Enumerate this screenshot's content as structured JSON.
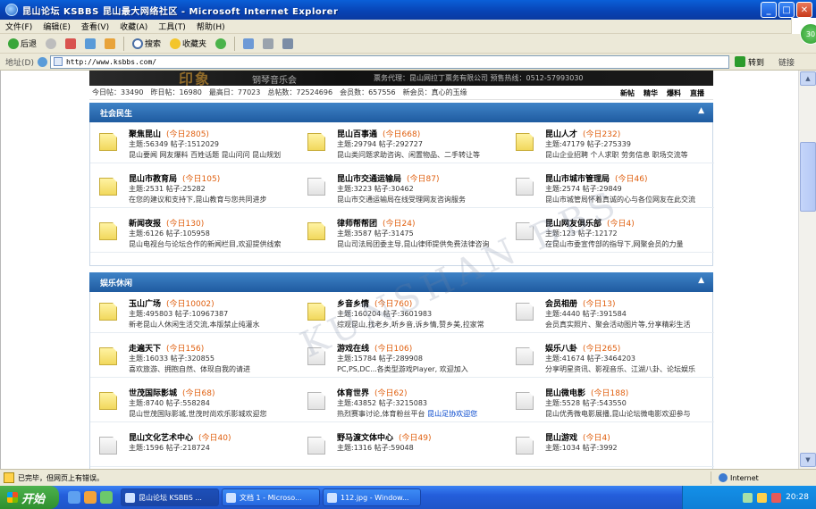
{
  "window": {
    "title": "昆山论坛 KSBBS 昆山最大网络社区 - Microsoft Internet Explorer"
  },
  "menu": [
    "文件(F)",
    "编辑(E)",
    "查看(V)",
    "收藏(A)",
    "工具(T)",
    "帮助(H)"
  ],
  "toolbar": {
    "back": "后退",
    "search": "搜索",
    "favorites": "收藏夹"
  },
  "address": {
    "label": "地址(D)",
    "url": "http://www.ksbbs.com/",
    "go": "转到",
    "links": "链接"
  },
  "banner": {
    "big_text": "印象",
    "sub_text": "钢琴音乐会",
    "info": "票务代理：昆山网拉丁票务有限公司    预售热线：0512-57993030"
  },
  "stats": {
    "today": "今日帖：33490",
    "yesterday": "昨日帖：16980",
    "max_day": "最高日：77023",
    "total": "总帖数：72524696",
    "members": "会员数：657556",
    "new_member": "新会员：真心的玉缘",
    "quick_links": [
      "新帖",
      "精华",
      "爆料",
      "直播"
    ]
  },
  "sections": [
    {
      "title": "社会民生",
      "collapse": "▲",
      "forums": [
        {
          "name": "聚焦昆山",
          "today": "(今日2805)",
          "stats": "主题:56349  帖子:1512029",
          "desc": "昆山要闻 网友爆料 百姓话题 昆山问问 昆山规划",
          "icon": "new"
        },
        {
          "name": "昆山百事通",
          "today": "(今日668)",
          "stats": "主题:29794  帖子:292727",
          "desc": "昆山类问题求助咨询、闲置物品、二手转让等",
          "icon": "new"
        },
        {
          "name": "昆山人才",
          "today": "(今日232)",
          "stats": "主题:47179  帖子:275339",
          "desc": "昆山企业招聘 个人求职 劳务信息 职场交流等",
          "icon": "new"
        },
        {
          "name": "昆山市教育局",
          "today": "(今日105)",
          "stats": "主题:2531  帖子:25282",
          "desc": "在您的建议和支持下,昆山教育与您共同进步",
          "icon": "new"
        },
        {
          "name": "昆山市交通运输局",
          "today": "(今日87)",
          "stats": "主题:3223  帖子:30462",
          "desc": "昆山市交通运输局在线受理网友咨询服务",
          "icon": "old"
        },
        {
          "name": "昆山市城市管理局",
          "today": "(今日46)",
          "stats": "主题:2574  帖子:29849",
          "desc": "昆山市城管局怀着真诚的心与各位网友在此交流",
          "icon": "old"
        },
        {
          "name": "新闻夜报",
          "today": "(今日130)",
          "stats": "主题:6126  帖子:105958",
          "desc": "昆山电视台与论坛合作的新闻栏目,欢迎提供线索",
          "icon": "new"
        },
        {
          "name": "律师帮帮团",
          "today": "(今日24)",
          "stats": "主题:3587  帖子:31475",
          "desc": "昆山司法局团委主导,昆山律师提供免费法律咨询",
          "icon": "new"
        },
        {
          "name": "昆山网友俱乐部",
          "today": "(今日4)",
          "stats": "主题:123  帖子:12172",
          "desc": "在昆山市委宣传部的指导下,网聚会员的力量",
          "icon": "old"
        }
      ]
    },
    {
      "title": "娱乐休闲",
      "collapse": "▲",
      "forums": [
        {
          "name": "玉山广场",
          "today": "(今日10002)",
          "stats": "主题:495803  帖子:10967387",
          "desc": "新老昆山人休闲生活交流,本版禁止纯灌水",
          "icon": "new"
        },
        {
          "name": "乡音乡情",
          "today": "(今日760)",
          "stats": "主题:160204  帖子:3601983",
          "desc": "综观昆山,找老乡,听乡音,诉乡情,赞乡美,拉家常",
          "icon": "new"
        },
        {
          "name": "会员相册",
          "today": "(今日13)",
          "stats": "主题:4440  帖子:391584",
          "desc": "会员真实照片、聚会活动图片等,分享精彩生活",
          "icon": "old"
        },
        {
          "name": "走遍天下",
          "today": "(今日156)",
          "stats": "主题:16033  帖子:320855",
          "desc": "喜欢旅游、拥抱自然、体现自我的请进",
          "icon": "new"
        },
        {
          "name": "游戏在线",
          "today": "(今日106)",
          "stats": "主题:15784  帖子:289908",
          "desc": "PC,PS,DC...各类型游戏Player, 欢迎加入",
          "icon": "old"
        },
        {
          "name": "娱乐八卦",
          "today": "(今日265)",
          "stats": "主题:41674  帖子:3464203",
          "desc": "分享明星资讯、影视音乐、江湖八卦、论坛娱乐",
          "icon": "old"
        },
        {
          "name": "世茂国际影城",
          "today": "(今日68)",
          "stats": "主题:8740  帖子:558284",
          "desc": "昆山世茂国际影城,世茂时尚欢乐影城欢迎您",
          "icon": "new"
        },
        {
          "name": "体育世界",
          "today": "(今日62)",
          "stats": "主题:43852  帖子:3215083",
          "desc": "热烈赛事讨论,体育粉丝平台",
          "desc_link": "昆山足协欢迎您",
          "icon": "old"
        },
        {
          "name": "昆山微电影",
          "today": "(今日188)",
          "stats": "主题:5528  帖子:543550",
          "desc": "昆山优秀微电影展播,昆山论坛微电影欢迎参与",
          "icon": "old"
        },
        {
          "name": "昆山文化艺术中心",
          "today": "(今日40)",
          "stats": "主题:1596  帖子:218724",
          "desc": "",
          "icon": "old"
        },
        {
          "name": "野马渡文体中心",
          "today": "(今日49)",
          "stats": "主题:1316  帖子:59048",
          "desc": "",
          "icon": "old"
        },
        {
          "name": "昆山游戏",
          "today": "(今日4)",
          "stats": "主题:1034  帖子:3992",
          "desc": "",
          "icon": "old"
        }
      ]
    }
  ],
  "watermark": "KUNSHAN BBS",
  "status": {
    "text": "已完毕，但网页上有错误。",
    "zone": "Internet"
  },
  "taskbar": {
    "start": "开始",
    "tasks": [
      "昆山论坛 KSBBS ...",
      "文档 1 - Microso...",
      "112.jpg - Window..."
    ],
    "clock": "20:28"
  },
  "colors": {
    "section_header": "#1f5ba0",
    "today_count": "#e06010",
    "taskbar": "#245edb",
    "titlebar": "#0842b3"
  }
}
